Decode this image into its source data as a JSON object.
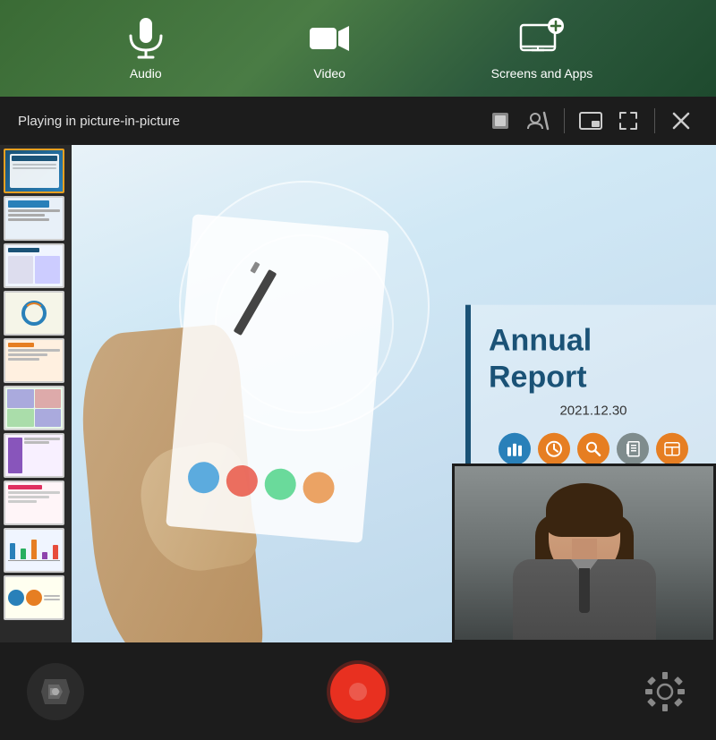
{
  "topBar": {
    "items": [
      {
        "id": "audio",
        "label": "Audio"
      },
      {
        "id": "video",
        "label": "Video"
      },
      {
        "id": "screens-apps",
        "label": "Screens and Apps"
      }
    ]
  },
  "controlBar": {
    "statusText": "Playing in picture-in-picture",
    "buttons": [
      {
        "id": "stop-video",
        "title": "Stop video"
      },
      {
        "id": "no-video",
        "title": "No video"
      },
      {
        "id": "pip",
        "title": "Picture in picture"
      },
      {
        "id": "fullscreen",
        "title": "Fullscreen"
      },
      {
        "id": "close",
        "title": "Close"
      }
    ]
  },
  "slide": {
    "title": "Annual Report",
    "date": "2021.12.30"
  },
  "bottomBar": {
    "recordTitle": "Record"
  }
}
